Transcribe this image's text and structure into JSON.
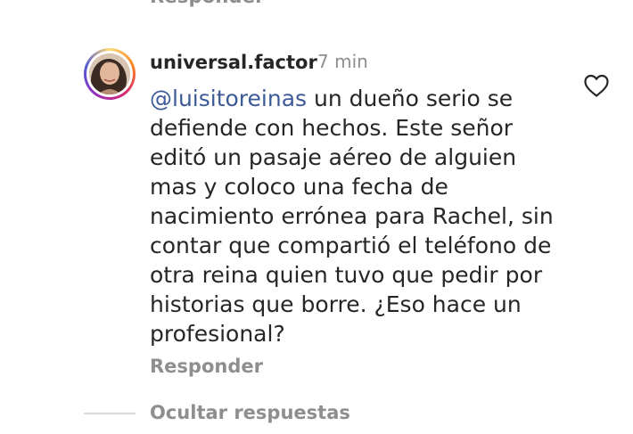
{
  "previous_reply_label": "Responder",
  "comment": {
    "username": "universal.factor",
    "time": "7 min",
    "mention": "@luisitoreinas",
    "text": " un dueño serio se defiende con hechos. Este señor editó un pasaje aéreo de alguien mas y coloco una fecha de nacimiento errónea para Rachel, sin contar que compartió el teléfono de otra reina quien tuvo que pedir por historias que borre. ¿Eso hace un profesional?",
    "reply_label": "Responder",
    "like_icon": "heart-outline-icon"
  },
  "hide_replies_label": "Ocultar respuestas",
  "colors": {
    "text": "#262626",
    "secondary": "#8e8e8e",
    "mention": "#3d5a98",
    "divider": "#dbdbdb"
  }
}
